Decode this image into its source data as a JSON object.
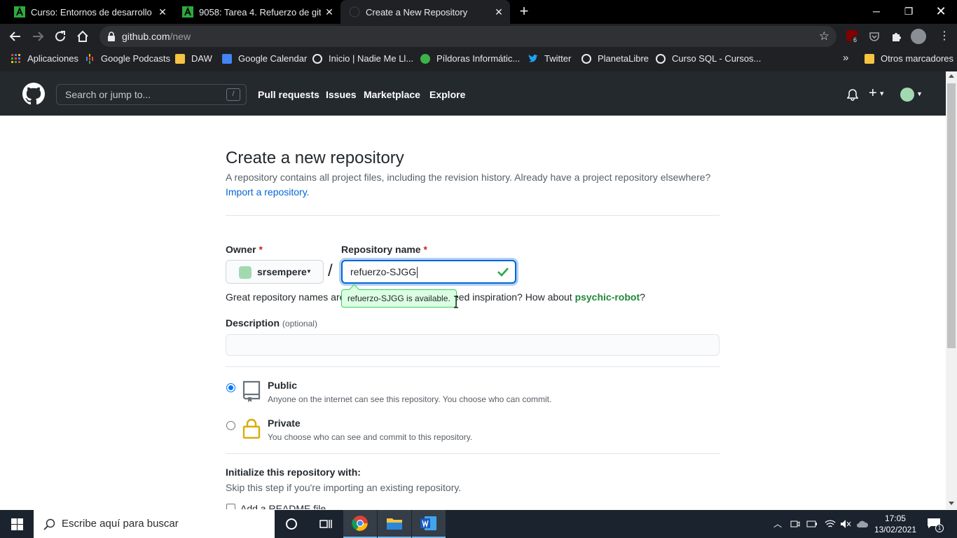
{
  "browser": {
    "tabs": [
      {
        "title": "Curso: Entornos de desarrollo",
        "favicon": "moodle-a-icon"
      },
      {
        "title": "9058: Tarea 4. Refuerzo de github",
        "favicon": "moodle-a-icon"
      },
      {
        "title": "Create a New Repository",
        "favicon": "github-icon",
        "active": true
      }
    ],
    "url_host": "github.com",
    "url_path": "/new",
    "extension_badge": "6",
    "bookmarks": [
      {
        "label": "Aplicaciones",
        "icon": "apps-grid-icon"
      },
      {
        "label": "Google Podcasts",
        "icon": "podcasts-icon"
      },
      {
        "label": "DAW",
        "icon": "folder-icon"
      },
      {
        "label": "Google Calendar",
        "icon": "calendar-icon"
      },
      {
        "label": "Inicio | Nadie Me Ll...",
        "icon": "globe-icon"
      },
      {
        "label": "Píldoras Informátic...",
        "icon": "pill-icon"
      },
      {
        "label": "Twitter",
        "icon": "twitter-icon"
      },
      {
        "label": "PlanetaLibre",
        "icon": "globe-icon"
      },
      {
        "label": "Curso SQL - Cursos...",
        "icon": "globe-icon"
      }
    ],
    "more_bookmarks_label": "»",
    "other_bookmarks": "Otros marcadores"
  },
  "github": {
    "search_placeholder": "Search or jump to...",
    "search_shortcut": "/",
    "nav": [
      "Pull requests",
      "Issues",
      "Marketplace",
      "Explore"
    ]
  },
  "page": {
    "title": "Create a new repository",
    "subtitle": "A repository contains all project files, including the revision history. Already have a project repository elsewhere?",
    "import_link": "Import a repository.",
    "owner_label": "Owner",
    "repo_label": "Repository name",
    "required_mark": "*",
    "owner_value": "srsempere",
    "separator": "/",
    "repo_value": "refuerzo-SJGG",
    "availability": "refuerzo-SJGG is available.",
    "hint_prefix": "Great repository names are short and memorable. Need inspiration? How about",
    "hint_visible_before": "Great repository names are",
    "hint_visible_after": "eed inspiration? How about",
    "hint_suggestion": "psychic-robot",
    "hint_end": "?",
    "description_label": "Description",
    "description_optional": "(optional)",
    "description_value": "",
    "visibility": [
      {
        "title": "Public",
        "desc": "Anyone on the internet can see this repository. You choose who can commit.",
        "checked": true,
        "icon": "repo-book-icon"
      },
      {
        "title": "Private",
        "desc": "You choose who can see and commit to this repository.",
        "checked": false,
        "icon": "lock-icon"
      }
    ],
    "init_title": "Initialize this repository with:",
    "init_sub": "Skip this step if you're importing an existing repository.",
    "readme_label": "Add a README file"
  },
  "taskbar": {
    "search_placeholder": "Escribe aquí para buscar",
    "time": "17:05",
    "date": "13/02/2021",
    "notifications_count": "1"
  },
  "colors": {
    "github_header": "#24292e",
    "link": "#0366d6",
    "success_green": "#28a745",
    "suggestion_green": "#22863a"
  }
}
